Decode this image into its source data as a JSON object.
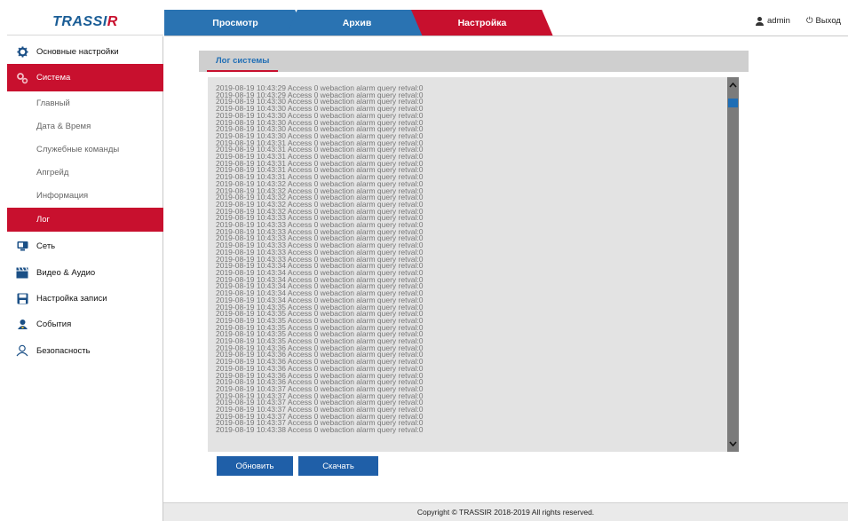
{
  "header": {
    "logo_main": "TRASSI",
    "logo_r": "R",
    "tabs": [
      {
        "label": "Просмотр"
      },
      {
        "label": "Архив"
      },
      {
        "label": "Настройка"
      }
    ],
    "user": "admin",
    "logout": "Выход"
  },
  "sidebar": {
    "items": [
      {
        "label": "Основные настройки",
        "icon": "gear-icon"
      },
      {
        "label": "Система",
        "icon": "system-gears-icon"
      },
      {
        "label": "Сеть",
        "icon": "network-icon"
      },
      {
        "label": "Видео & Аудио",
        "icon": "clapperboard-icon"
      },
      {
        "label": "Настройка записи",
        "icon": "floppy-icon"
      },
      {
        "label": "События",
        "icon": "event-person-icon"
      },
      {
        "label": "Безопасность",
        "icon": "user-outline-icon"
      }
    ],
    "sub_items": [
      {
        "label": "Главный"
      },
      {
        "label": "Дата & Время"
      },
      {
        "label": "Служебные команды"
      },
      {
        "label": "Апгрейд"
      },
      {
        "label": "Информация"
      },
      {
        "label": "Лог"
      }
    ]
  },
  "log": {
    "tab_label": "Лог системы",
    "lines": [
      "2019-08-19 10:43:29 Access 0 webaction alarm query retval:0",
      "2019-08-19 10:43:29 Access 0 webaction alarm query retval:0",
      "2019-08-19 10:43:30 Access 0 webaction alarm query retval:0",
      "2019-08-19 10:43:30 Access 0 webaction alarm query retval:0",
      "2019-08-19 10:43:30 Access 0 webaction alarm query retval:0",
      "2019-08-19 10:43:30 Access 0 webaction alarm query retval:0",
      "2019-08-19 10:43:30 Access 0 webaction alarm query retval:0",
      "2019-08-19 10:43:30 Access 0 webaction alarm query retval:0",
      "2019-08-19 10:43:31 Access 0 webaction alarm query retval:0",
      "2019-08-19 10:43:31 Access 0 webaction alarm query retval:0",
      "2019-08-19 10:43:31 Access 0 webaction alarm query retval:0",
      "2019-08-19 10:43:31 Access 0 webaction alarm query retval:0",
      "2019-08-19 10:43:31 Access 0 webaction alarm query retval:0",
      "2019-08-19 10:43:31 Access 0 webaction alarm query retval:0",
      "2019-08-19 10:43:32 Access 0 webaction alarm query retval:0",
      "2019-08-19 10:43:32 Access 0 webaction alarm query retval:0",
      "2019-08-19 10:43:32 Access 0 webaction alarm query retval:0",
      "2019-08-19 10:43:32 Access 0 webaction alarm query retval:0",
      "2019-08-19 10:43:32 Access 0 webaction alarm query retval:0",
      "2019-08-19 10:43:33 Access 0 webaction alarm query retval:0",
      "2019-08-19 10:43:33 Access 0 webaction alarm query retval:0",
      "2019-08-19 10:43:33 Access 0 webaction alarm query retval:0",
      "2019-08-19 10:43:33 Access 0 webaction alarm query retval:0",
      "2019-08-19 10:43:33 Access 0 webaction alarm query retval:0",
      "2019-08-19 10:43:33 Access 0 webaction alarm query retval:0",
      "2019-08-19 10:43:33 Access 0 webaction alarm query retval:0",
      "2019-08-19 10:43:34 Access 0 webaction alarm query retval:0",
      "2019-08-19 10:43:34 Access 0 webaction alarm query retval:0",
      "2019-08-19 10:43:34 Access 0 webaction alarm query retval:0",
      "2019-08-19 10:43:34 Access 0 webaction alarm query retval:0",
      "2019-08-19 10:43:34 Access 0 webaction alarm query retval:0",
      "2019-08-19 10:43:34 Access 0 webaction alarm query retval:0",
      "2019-08-19 10:43:35 Access 0 webaction alarm query retval:0",
      "2019-08-19 10:43:35 Access 0 webaction alarm query retval:0",
      "2019-08-19 10:43:35 Access 0 webaction alarm query retval:0",
      "2019-08-19 10:43:35 Access 0 webaction alarm query retval:0",
      "2019-08-19 10:43:35 Access 0 webaction alarm query retval:0",
      "2019-08-19 10:43:35 Access 0 webaction alarm query retval:0",
      "2019-08-19 10:43:36 Access 0 webaction alarm query retval:0",
      "2019-08-19 10:43:36 Access 0 webaction alarm query retval:0",
      "2019-08-19 10:43:36 Access 0 webaction alarm query retval:0",
      "2019-08-19 10:43:36 Access 0 webaction alarm query retval:0",
      "2019-08-19 10:43:36 Access 0 webaction alarm query retval:0",
      "2019-08-19 10:43:36 Access 0 webaction alarm query retval:0",
      "2019-08-19 10:43:37 Access 0 webaction alarm query retval:0",
      "2019-08-19 10:43:37 Access 0 webaction alarm query retval:0",
      "2019-08-19 10:43:37 Access 0 webaction alarm query retval:0",
      "2019-08-19 10:43:37 Access 0 webaction alarm query retval:0",
      "2019-08-19 10:43:37 Access 0 webaction alarm query retval:0",
      "2019-08-19 10:43:37 Access 0 webaction alarm query retval:0",
      "2019-08-19 10:43:38 Access 0 webaction alarm query retval:0"
    ],
    "refresh_label": "Обновить",
    "download_label": "Скачать"
  },
  "footer": {
    "copyright": "Copyright © TRASSIR 2018-2019 All rights reserved."
  },
  "colors": {
    "accent_red": "#c8102e",
    "accent_blue": "#2a73b2",
    "button_blue": "#1f5fa8"
  }
}
